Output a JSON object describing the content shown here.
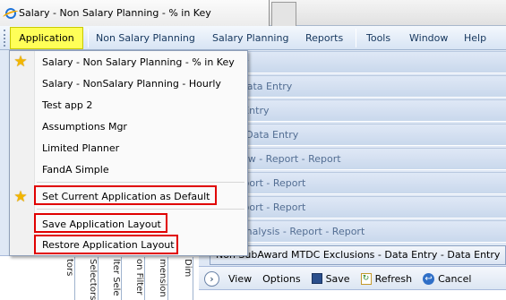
{
  "browser": {
    "tab_title": "Salary - Non Salary Planning - % in Key"
  },
  "menubar": {
    "items": [
      "Application",
      "Non Salary Planning",
      "Salary Planning",
      "Reports",
      "Tools",
      "Window",
      "Help"
    ]
  },
  "background_rows": [
    "ta Entry",
    "ntry - Data Entry",
    "- Data Entry",
    "Entry - Data Entry",
    "ual - New - Report - Report",
    "es - Report - Report",
    "es - Report - Report",
    "ecast Analysis - Report - Report"
  ],
  "active_window": {
    "title": "Non SubAward MTDC Exclusions - Data Entry - Data Entry"
  },
  "toolbar": {
    "view": "View",
    "options": "Options",
    "save": "Save",
    "refresh": "Refresh",
    "cancel": "Cancel"
  },
  "left_columns": [
    "tors",
    "Selectors",
    "lter Sele",
    "on Filter",
    "mension",
    "Dim",
    "D"
  ],
  "dropdown": {
    "apps": [
      "Salary - Non Salary Planning - % in Key",
      "Salary - NonSalary Planning - Hourly",
      "Test app 2",
      "Assumptions Mgr",
      "Limited Planner",
      "FandA Simple"
    ],
    "set_default": "Set Current Application as Default",
    "save_layout": "Save Application Layout",
    "restore_layout": "Restore Application Layout"
  },
  "colors": {
    "highlight": "#ffff58",
    "callout": "#e00000",
    "star": "#f2b600"
  }
}
